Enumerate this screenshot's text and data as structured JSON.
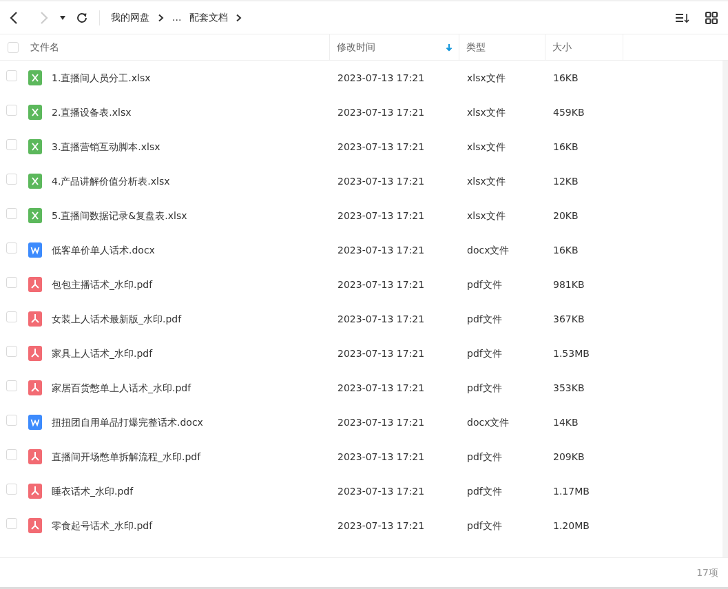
{
  "toolbar": {
    "back_disabled": false,
    "forward_disabled": true
  },
  "breadcrumb": [
    {
      "label": "我的网盘"
    },
    {
      "label": "..."
    },
    {
      "label": "配套文档"
    }
  ],
  "table": {
    "select_all_checked": false,
    "columns": [
      {
        "label": "文件名",
        "sorted": false
      },
      {
        "label": "修改时间",
        "sorted": true
      },
      {
        "label": "类型",
        "sorted": false
      },
      {
        "label": "大小",
        "sorted": false
      }
    ],
    "rows": [
      {
        "kind": "xlsx",
        "name": "1.直播间人员分工.xlsx",
        "modified": "2023-07-13 17:21",
        "type": "xlsx文件",
        "size": "16KB",
        "checked": false
      },
      {
        "kind": "xlsx",
        "name": "2.直播设备表.xlsx",
        "modified": "2023-07-13 17:21",
        "type": "xlsx文件",
        "size": "459KB",
        "checked": false
      },
      {
        "kind": "xlsx",
        "name": "3.直播营销互动脚本.xlsx",
        "modified": "2023-07-13 17:21",
        "type": "xlsx文件",
        "size": "16KB",
        "checked": false
      },
      {
        "kind": "xlsx",
        "name": "4.产品讲解价值分析表.xlsx",
        "modified": "2023-07-13 17:21",
        "type": "xlsx文件",
        "size": "12KB",
        "checked": false
      },
      {
        "kind": "xlsx",
        "name": "5.直播间数据记录&复盘表.xlsx",
        "modified": "2023-07-13 17:21",
        "type": "xlsx文件",
        "size": "20KB",
        "checked": false
      },
      {
        "kind": "docx",
        "name": "低客单价单人话术.docx",
        "modified": "2023-07-13 17:21",
        "type": "docx文件",
        "size": "16KB",
        "checked": false
      },
      {
        "kind": "pdf",
        "name": "包包主播话术_水印.pdf",
        "modified": "2023-07-13 17:21",
        "type": "pdf文件",
        "size": "981KB",
        "checked": false
      },
      {
        "kind": "pdf",
        "name": "女装上人话术最新版_水印.pdf",
        "modified": "2023-07-13 17:21",
        "type": "pdf文件",
        "size": "367KB",
        "checked": false
      },
      {
        "kind": "pdf",
        "name": "家具上人话术_水印.pdf",
        "modified": "2023-07-13 17:21",
        "type": "pdf文件",
        "size": "1.53MB",
        "checked": false
      },
      {
        "kind": "pdf",
        "name": "家居百货憋单上人话术_水印.pdf",
        "modified": "2023-07-13 17:21",
        "type": "pdf文件",
        "size": "353KB",
        "checked": false
      },
      {
        "kind": "docx",
        "name": "扭扭团自用单品打爆完整话术.docx",
        "modified": "2023-07-13 17:21",
        "type": "docx文件",
        "size": "14KB",
        "checked": false
      },
      {
        "kind": "pdf",
        "name": "直播间开场憋单拆解流程_水印.pdf",
        "modified": "2023-07-13 17:21",
        "type": "pdf文件",
        "size": "209KB",
        "checked": false
      },
      {
        "kind": "pdf",
        "name": "睡衣话术_水印.pdf",
        "modified": "2023-07-13 17:21",
        "type": "pdf文件",
        "size": "1.17MB",
        "checked": false
      },
      {
        "kind": "pdf",
        "name": "零食起号话术_水印.pdf",
        "modified": "2023-07-13 17:21",
        "type": "pdf文件",
        "size": "1.20MB",
        "checked": false
      }
    ]
  },
  "status_bar": {
    "count": "17项"
  }
}
